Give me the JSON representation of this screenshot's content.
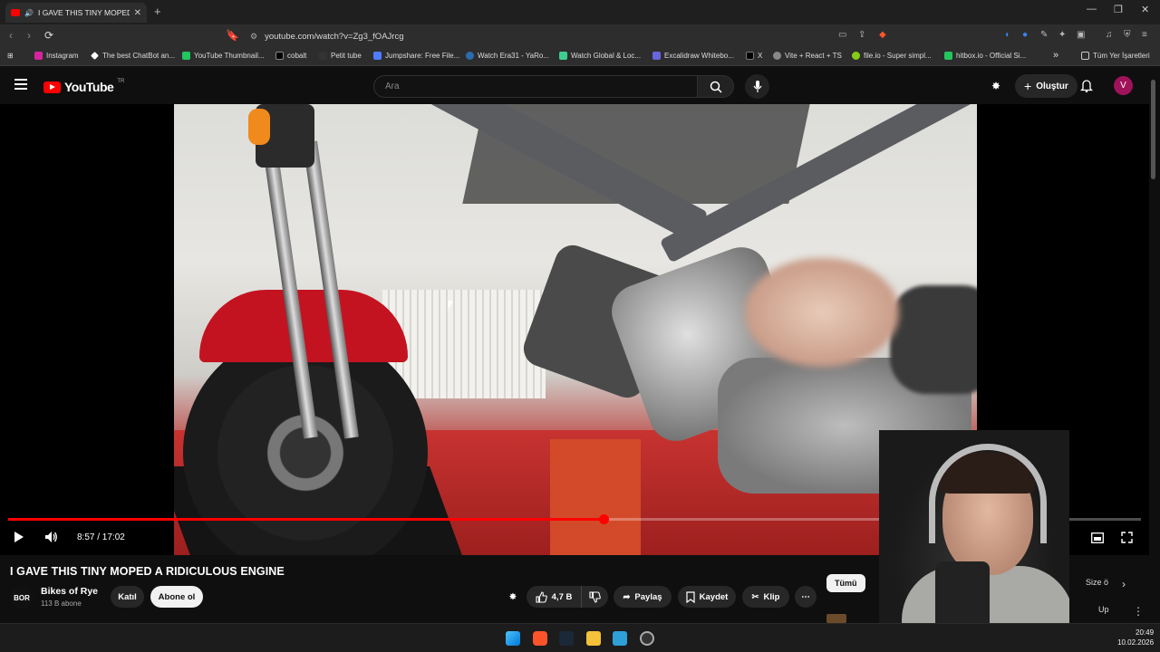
{
  "browser": {
    "tab_title": "I GAVE THIS TINY MOPED A R",
    "new_tab": "+",
    "url": "youtube.com/watch?v=Zg3_fOAJrcg",
    "bookmarks": [
      "Instagram",
      "The best ChatBot an...",
      "YouTube Thumbnail...",
      "cobalt",
      "Petit tube",
      "Jumpshare: Free File...",
      "Watch Era31 - YaRo...",
      "Watch Global & Loc...",
      "Excalidraw Whitebo...",
      "X",
      "Vite + React + TS",
      "file.io - Super simpl...",
      "hitbox.io - Official Si..."
    ],
    "bookmarks_overflow": "»",
    "all_bookmarks": "Tüm Yer İşaretleri"
  },
  "youtube": {
    "logo_text": "YouTube",
    "country_code": "TR",
    "search_placeholder": "Ara",
    "create_label": "Oluştur",
    "avatar_letter": "V"
  },
  "player": {
    "current_time": "8:57",
    "duration": "17:02",
    "time_display": "8:57 / 17:02",
    "progress_fraction": 0.5259
  },
  "video": {
    "title": "I GAVE THIS TINY MOPED A RIDICULOUS ENGINE",
    "channel_name": "Bikes of Rye",
    "channel_initials": "BOR",
    "subscribers": "113 B abone",
    "join_label": "Katıl",
    "subscribe_label": "Abone ol",
    "likes": "4,7 B",
    "share_label": "Paylaş",
    "save_label": "Kaydet",
    "clip_label": "Klip"
  },
  "sidebar": {
    "chip_all": "Tümü",
    "chip_partial": "Size ö",
    "partial_text": "Up"
  },
  "taskbar": {
    "time": "20:49",
    "date": "10.02.2026"
  }
}
